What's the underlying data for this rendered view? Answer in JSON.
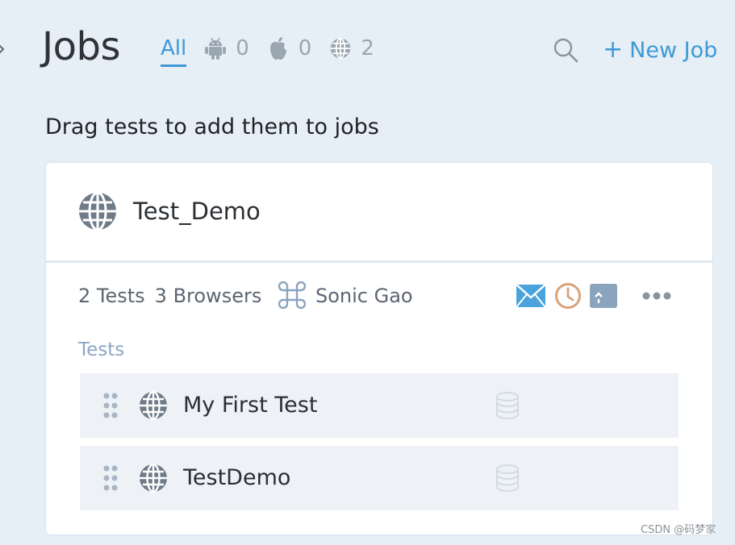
{
  "header": {
    "title": "Jobs",
    "filters": {
      "all_label": "All",
      "android_count": "0",
      "ios_count": "0",
      "web_count": "2"
    },
    "new_job_label": "New Job",
    "new_job_plus": "+"
  },
  "subtitle": "Drag tests to add them to jobs",
  "job": {
    "name": "Test_Demo",
    "tests_count": "2 Tests",
    "browsers_count": "3 Browsers",
    "owner": "Sonic Gao",
    "tests_section_label": "Tests",
    "tests": [
      {
        "name": "My First Test"
      },
      {
        "name": "TestDemo"
      }
    ]
  },
  "watermark": "CSDN @码梦家",
  "colors": {
    "accent": "#3d9ad6",
    "background": "#e6eef6",
    "row_background": "#eef2f7",
    "mail_blue": "#4aa3dc",
    "clock_orange": "#d9a27b",
    "upload_slate": "#8ba4bd",
    "globe_gray": "#6f7b88"
  },
  "icons": [
    "android-icon",
    "apple-icon",
    "globe-icon",
    "search-icon",
    "command-icon",
    "mail-icon",
    "clock-icon",
    "upload-icon",
    "more-icon",
    "drag-handle-icon",
    "database-icon"
  ]
}
